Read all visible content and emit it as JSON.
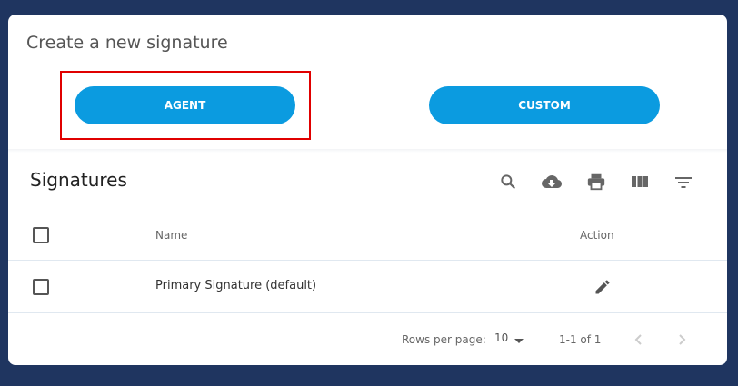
{
  "create": {
    "title": "Create a new signature",
    "agent_label": "AGENT",
    "custom_label": "CUSTOM"
  },
  "signatures": {
    "title": "Signatures",
    "toolbar_icons": [
      "search-icon",
      "cloud-download-icon",
      "print-icon",
      "view-column-icon",
      "filter-list-icon"
    ],
    "columns": {
      "name": "Name",
      "action": "Action"
    },
    "rows": [
      {
        "name": "Primary Signature (default)",
        "action_icon": "edit-icon"
      }
    ],
    "footer": {
      "rows_per_page_label": "Rows per page:",
      "rows_per_page_value": "10",
      "range": "1-1 of 1"
    }
  },
  "colors": {
    "background": "#1f3560",
    "button": "#0b9be0",
    "highlight": "#e00000"
  }
}
